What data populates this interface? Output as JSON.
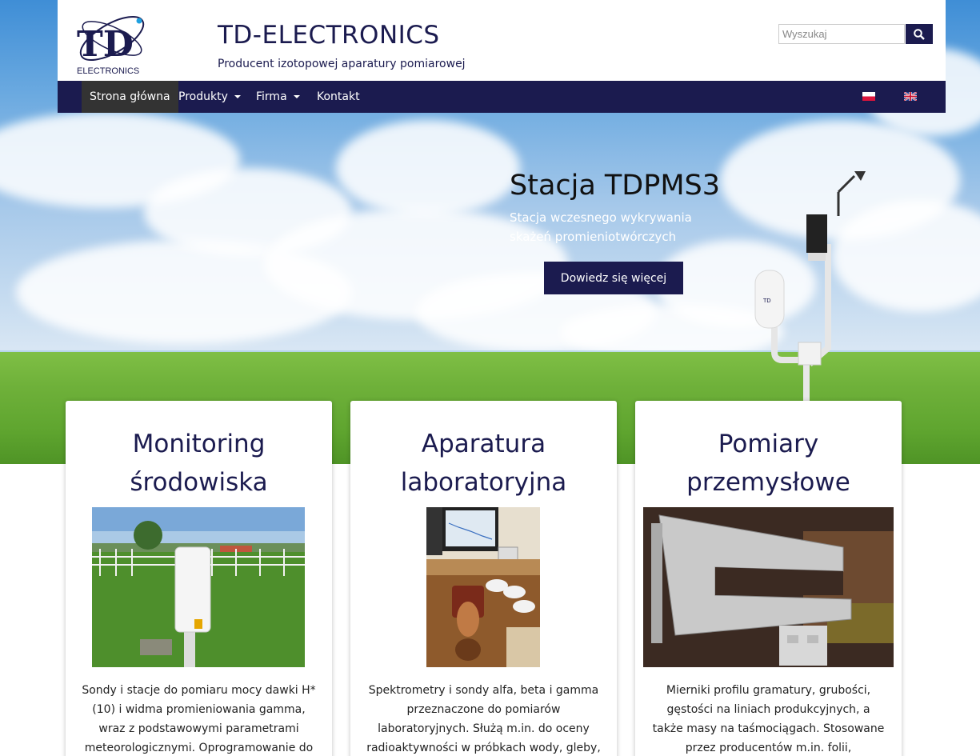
{
  "header": {
    "site_title": "TD-ELECTRONICS",
    "tagline": "Producent izotopowej aparatury pomiarowej",
    "logo_text": "ELECTRONICS",
    "logo_letters": "TD",
    "search": {
      "placeholder": "Wyszukaj",
      "icon": "search-icon"
    }
  },
  "nav": {
    "items": [
      {
        "label": "Strona główna",
        "active": true,
        "dropdown": false
      },
      {
        "label": "Produkty",
        "active": false,
        "dropdown": true
      },
      {
        "label": "Firma",
        "active": false,
        "dropdown": true
      },
      {
        "label": "Kontakt",
        "active": false,
        "dropdown": false
      }
    ],
    "languages": [
      "pl-flag-icon",
      "uk-flag-icon"
    ]
  },
  "hero": {
    "title": "Stacja TDPMS3",
    "subtitle": "Stacja wczesnego wykrywania skażeń promieniotwórczych",
    "button_label": "Dowiedz się więcej"
  },
  "cards": [
    {
      "title": "Monitoring środowiska",
      "text": "Sondy i stacje do pomiaru mocy dawki H*(10) i widma promieniowania gamma, wraz z podstawowymi parametrami meteorologicznymi. Oprogramowanie do"
    },
    {
      "title": "Aparatura laboratoryjna",
      "text": "Spektrometry i sondy alfa, beta i gamma przeznaczone do pomiarów laboratoryjnych. Służą m.in. do oceny radioaktywności w próbkach wody, gleby,"
    },
    {
      "title": "Pomiary przemysłowe",
      "text": "Mierniki profilu gramatury, grubości, gęstości na liniach produkcyjnych, a także masy na taśmociągach. Stosowane przez producentów m.in. folii,"
    }
  ],
  "colors": {
    "brand_navy": "#1b1b4f",
    "nav_active": "#333333"
  }
}
